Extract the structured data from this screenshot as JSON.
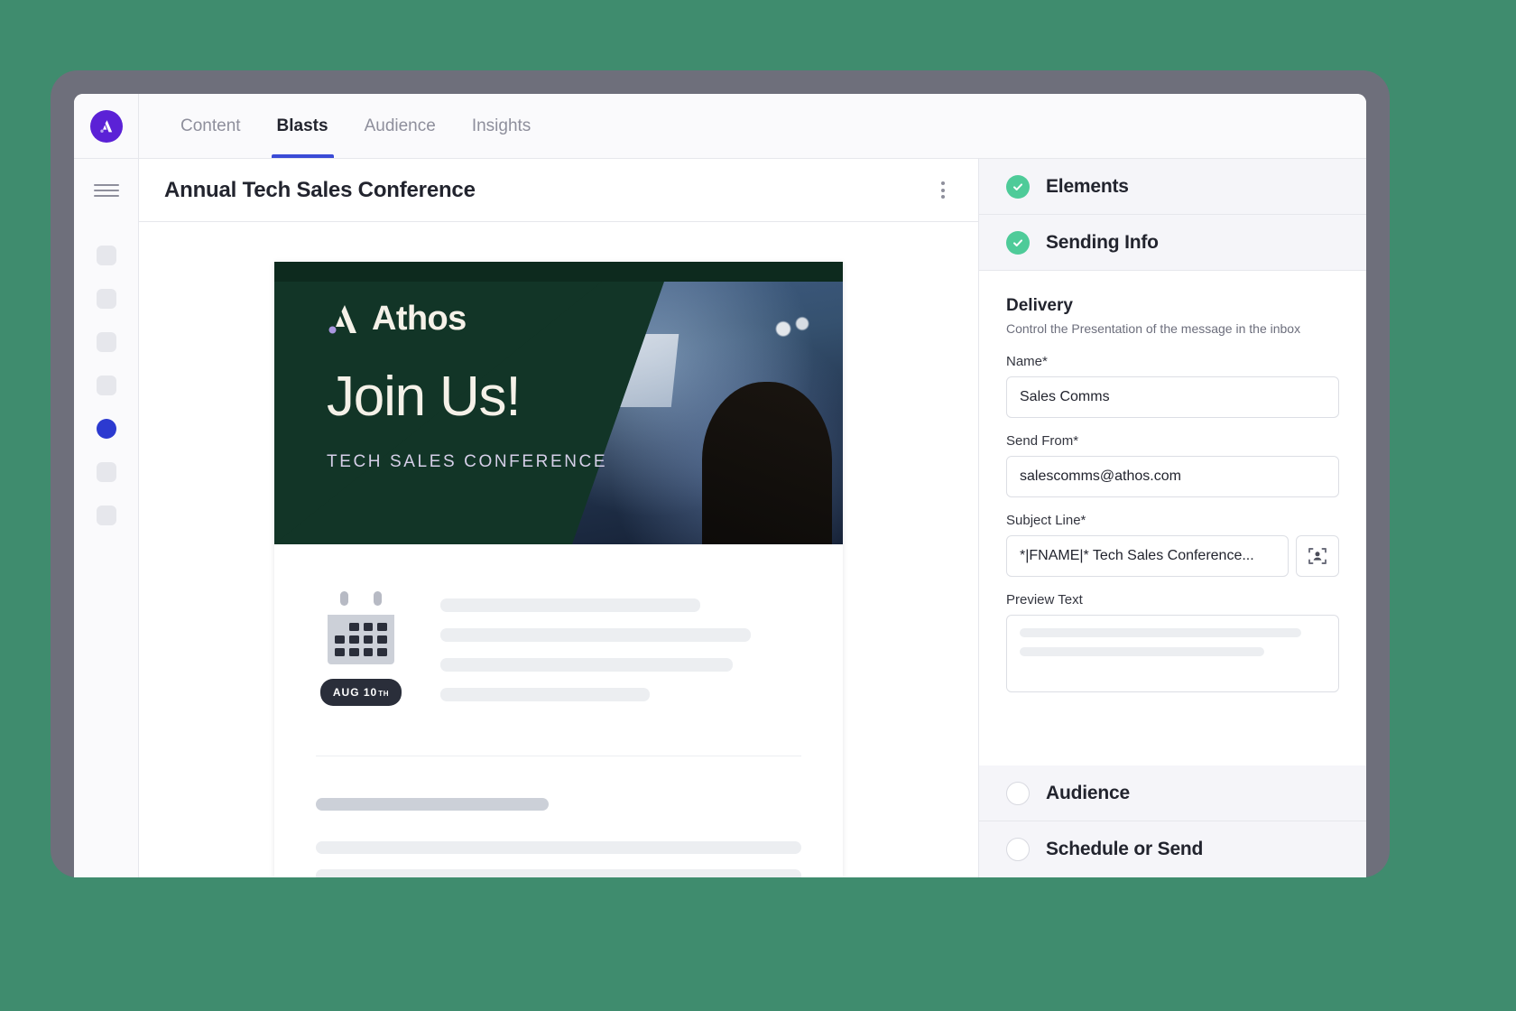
{
  "nav": {
    "brand_icon": "athos-logo-icon",
    "tabs": [
      {
        "label": "Content",
        "active": false
      },
      {
        "label": "Blasts",
        "active": true
      },
      {
        "label": "Audience",
        "active": false
      },
      {
        "label": "Insights",
        "active": false
      }
    ]
  },
  "canvas": {
    "title": "Annual Tech Sales Conference",
    "menu_icon": "kebab-menu-icon",
    "hamburger_icon": "hamburger-menu-icon"
  },
  "rail": {
    "items": [
      {
        "id": "step-1",
        "active": false
      },
      {
        "id": "step-2",
        "active": false
      },
      {
        "id": "step-3",
        "active": false
      },
      {
        "id": "step-4",
        "active": false
      },
      {
        "id": "step-5",
        "active": true
      },
      {
        "id": "step-6",
        "active": false
      },
      {
        "id": "step-7",
        "active": false
      }
    ]
  },
  "email": {
    "logo_text": "Athos",
    "headline": "Join Us!",
    "subhead": "TECH SALES CONFERENCE",
    "date_badge": {
      "month_day": "AUG 10",
      "ordinal": "TH"
    },
    "colors": {
      "hero_green": "#123527",
      "hero_green_dark": "#0d2a1e",
      "cream": "#f5f1e8",
      "lavender": "#d6cfe8"
    }
  },
  "right_panel": {
    "sections": [
      {
        "label": "Elements",
        "status": "done"
      },
      {
        "label": "Sending Info",
        "status": "done"
      },
      {
        "label": "Audience",
        "status": "todo"
      },
      {
        "label": "Schedule or Send",
        "status": "todo"
      }
    ],
    "delivery": {
      "title": "Delivery",
      "description": "Control the Presentation of the message in the inbox",
      "fields": {
        "name": {
          "label": "Name*",
          "value": "Sales Comms"
        },
        "send_from": {
          "label": "Send From*",
          "value": "salescomms@athos.com"
        },
        "subject_line": {
          "label": "Subject Line*",
          "value": "*|FNAME|* Tech Sales Conference...",
          "action_icon": "personalization-scan-icon"
        },
        "preview_text": {
          "label": "Preview Text",
          "value": ""
        }
      }
    }
  },
  "theme": {
    "accent_blue": "#3a4bd6",
    "brand_purple": "#5b21d6",
    "success_green": "#4ecb99",
    "frame_gray": "#6e6f7b",
    "page_bg": "#3f8c6e"
  }
}
